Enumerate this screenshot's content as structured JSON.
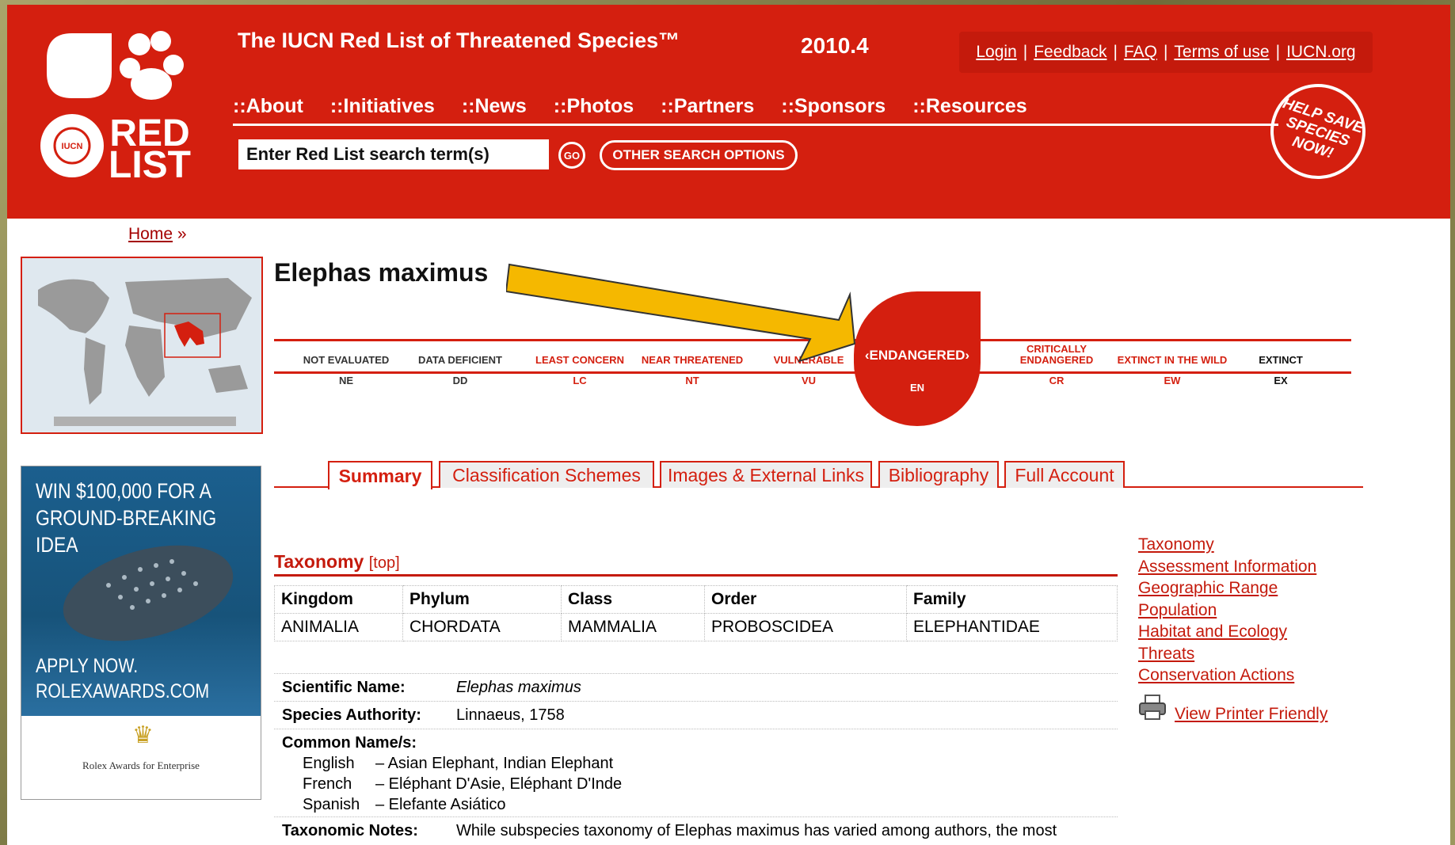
{
  "header": {
    "logo_text": "RED LIST",
    "logo_badge": "IUCN",
    "title": "The IUCN Red List of Threatened Species™",
    "year": "2010.4",
    "top_links": [
      "Login",
      "Feedback",
      "FAQ",
      "Terms of use",
      "IUCN.org"
    ],
    "nav": [
      "::About",
      "::Initiatives",
      "::News",
      "::Photos",
      "::Partners",
      "::Sponsors",
      "::Resources"
    ],
    "search_value": "Enter Red List search term(s)",
    "go_label": "GO",
    "other_search_label": "OTHER SEARCH OPTIONS",
    "help_badge": "HELP SAVE SPECIES NOW!"
  },
  "breadcrumb": {
    "home": "Home",
    "sep": "»"
  },
  "ad": {
    "headline": "WIN $100,000 FOR A GROUND-BREAKING IDEA",
    "cta": "APPLY NOW. ROLEXAWARDS.COM",
    "brand": "Rolex Awards for Enterprise"
  },
  "species": {
    "name": "Elephas maximus"
  },
  "status_scale": [
    {
      "name": "NOT EVALUATED",
      "code": "NE",
      "color": "#333333"
    },
    {
      "name": "DATA DEFICIENT",
      "code": "DD",
      "color": "#333333"
    },
    {
      "name": "LEAST CONCERN",
      "code": "LC",
      "color": "#d41f0f"
    },
    {
      "name": "NEAR THREATENED",
      "code": "NT",
      "color": "#d41f0f"
    },
    {
      "name": "VULNERABLE",
      "code": "VU",
      "color": "#d41f0f"
    },
    {
      "name": "ENDANGERED",
      "code": "EN",
      "color": "#ffffff"
    },
    {
      "name": "CRITICALLY ENDANGERED",
      "code": "CR",
      "color": "#d41f0f"
    },
    {
      "name": "EXTINCT IN THE WILD",
      "code": "EW",
      "color": "#d41f0f"
    },
    {
      "name": "EXTINCT",
      "code": "EX",
      "color": "#111111"
    }
  ],
  "current_status": {
    "label": "‹ENDANGERED›",
    "code": "EN"
  },
  "tabs": [
    "Summary",
    "Classification Schemes",
    "Images & External Links",
    "Bibliography",
    "Full Account"
  ],
  "taxonomy": {
    "heading": "Taxonomy",
    "top_link": "[top]",
    "headers": [
      "Kingdom",
      "Phylum",
      "Class",
      "Order",
      "Family"
    ],
    "values": [
      "ANIMALIA",
      "CHORDATA",
      "MAMMALIA",
      "PROBOSCIDEA",
      "ELEPHANTIDAE"
    ],
    "scientific_name_label": "Scientific Name:",
    "scientific_name": "Elephas maximus",
    "authority_label": "Species Authority:",
    "authority": "Linnaeus, 1758",
    "common_names_label": "Common Name/s:",
    "common_names": [
      {
        "lang": "English",
        "names": "– Asian Elephant, Indian Elephant"
      },
      {
        "lang": "French",
        "names": "– Eléphant D'Asie, Eléphant D'Inde"
      },
      {
        "lang": "Spanish",
        "names": "– Elefante Asiático"
      }
    ],
    "notes_label": "Taxonomic Notes:",
    "notes": "While subspecies taxonomy of Elephas maximus has varied among authors, the most"
  },
  "side_links": [
    "Taxonomy",
    "Assessment Information",
    "Geographic Range",
    "Population",
    "Habitat and Ecology",
    "Threats",
    "Conservation Actions"
  ],
  "printer_link": "View Printer Friendly",
  "colors": {
    "brand_red": "#d41f0f",
    "arrow": "#f5b800"
  }
}
